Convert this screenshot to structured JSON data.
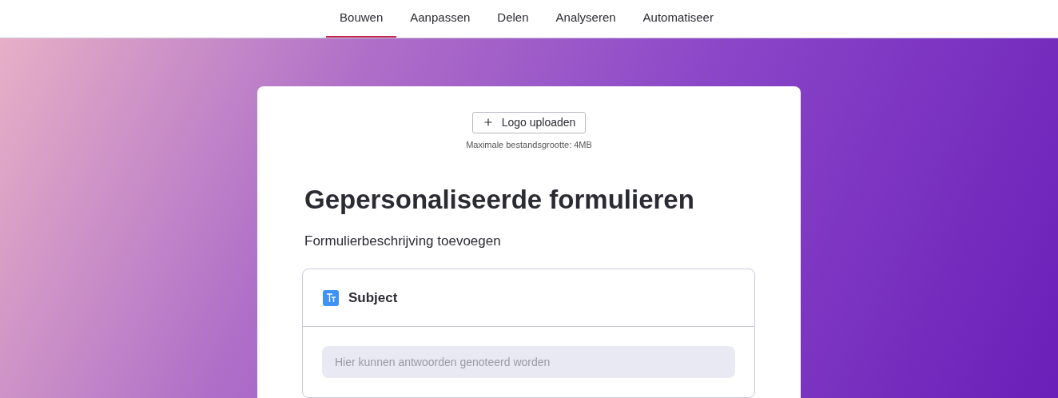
{
  "tabs": [
    {
      "label": "Bouwen",
      "selected": true
    },
    {
      "label": "Aanpassen",
      "selected": false
    },
    {
      "label": "Delen",
      "selected": false
    },
    {
      "label": "Analyseren",
      "selected": false
    },
    {
      "label": "Automatiseer",
      "selected": false
    }
  ],
  "form": {
    "logo_button": "Logo uploaden",
    "logo_hint": "Maximale bestandsgrootte: 4MB",
    "title": "Gepersonaliseerde formulieren",
    "description": "Formulierbeschrijving toevoegen",
    "questions": [
      {
        "kind": "text",
        "label": "Subject",
        "placeholder": "Hier kunnen antwoorden genoteerd worden"
      }
    ]
  }
}
